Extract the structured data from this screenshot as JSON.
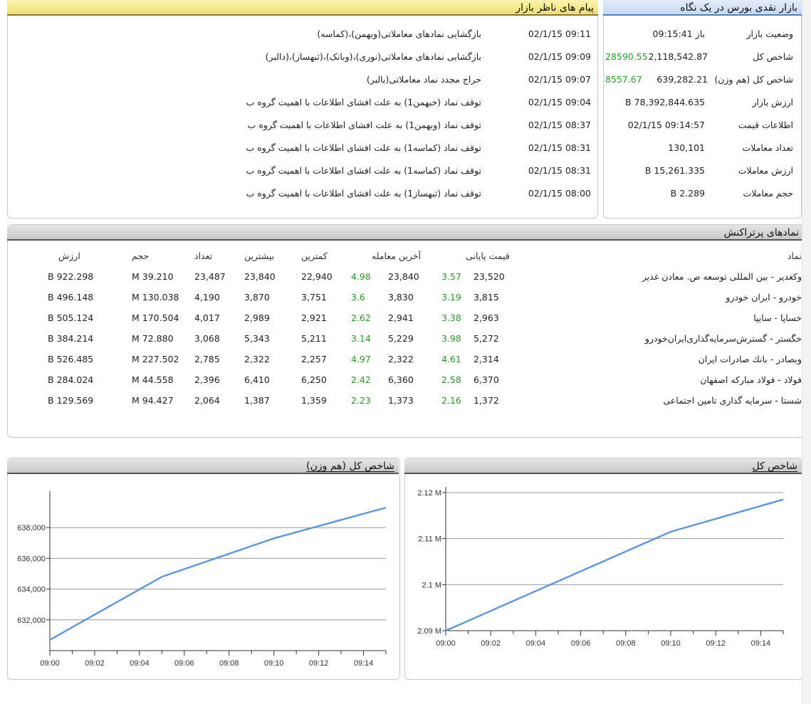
{
  "market_overview": {
    "title": "بازار نقدی بورس در یک نگاه",
    "rows": [
      {
        "label": "وضعیت بازار",
        "value": "باز 09:15:41",
        "extra": ""
      },
      {
        "label": "شاخص کل",
        "value": "2,118,542.87",
        "extra": "28590.55"
      },
      {
        "label": "شاخص کل (هم وزن)",
        "value": "639,282.21",
        "extra": "8557.67"
      },
      {
        "label": "ارزش بازار",
        "value": "78,392,844.635 B",
        "extra": ""
      },
      {
        "label": "اطلاعات قیمت",
        "value": "09:14:57 02/1/15",
        "extra": ""
      },
      {
        "label": "تعداد معاملات",
        "value": "130,101",
        "extra": ""
      },
      {
        "label": "ارزش معاملات",
        "value": "15,261.335 B",
        "extra": ""
      },
      {
        "label": "حجم معاملات",
        "value": "2.289 B",
        "extra": ""
      }
    ]
  },
  "messages": {
    "title": "پیام های ناظر بازار",
    "items": [
      {
        "time": "02/1/15 09:11",
        "text": "بازگشایی نمادهای معاملاتی(وبهمن)،(کماسه)"
      },
      {
        "time": "02/1/15 09:09",
        "text": "بازگشایی نمادهای معاملاتی(نوری)،(وبانک)،(ثبهساز)،(دالبر)"
      },
      {
        "time": "02/1/15 09:07",
        "text": "حراج مجدد نماد معاملاتی(بالبر)"
      },
      {
        "time": "02/1/15 09:04",
        "text": "توقف نماد (خبهمن1) به علت افشای اطلاعات با اهمیت گروه ب"
      },
      {
        "time": "02/1/15 08:37",
        "text": "توقف نماد (وبهمن1) به علت افشای اطلاعات با اهمیت گروه ب"
      },
      {
        "time": "02/1/15 08:31",
        "text": "توقف نماد (کماسه1) به علت افشای اطلاعات با اهمیت گروه ب"
      },
      {
        "time": "02/1/15 08:31",
        "text": "توقف نماد (کماسه1) به علت افشای اطلاعات با اهمیت گروه ب"
      },
      {
        "time": "02/1/15 08:00",
        "text": "توقف نماد (ثبهساز1) به علت افشای اطلاعات با اهمیت گروه ب"
      }
    ]
  },
  "effective_symbols": {
    "title": "نمادهای پرتراکنش",
    "headers": {
      "symbol": "نماد",
      "closing": "قیمت پایانی",
      "last": "آخرین معامله",
      "min": "کمترین",
      "max": "بیشترین",
      "count": "تعداد",
      "volume": "حجم",
      "value": "ارزش"
    },
    "rows": [
      {
        "symbol": "وکغدیر - بین المللی توسعه ص. معادن غدیر",
        "closing": "23,520",
        "closing_pct": "3.57",
        "last": "23,840",
        "last_pct": "4.98",
        "min": "22,940",
        "max": "23,840",
        "count": "23,487",
        "volume": "39.210 M",
        "value": "922.298 B"
      },
      {
        "symbol": "خودرو - ایران خودرو",
        "closing": "3,815",
        "closing_pct": "3.19",
        "last": "3,830",
        "last_pct": "3.6",
        "min": "3,751",
        "max": "3,870",
        "count": "4,190",
        "volume": "130.038 M",
        "value": "496.148 B"
      },
      {
        "symbol": "خساپا - سایپا",
        "closing": "2,963",
        "closing_pct": "3.38",
        "last": "2,941",
        "last_pct": "2.62",
        "min": "2,921",
        "max": "2,989",
        "count": "4,017",
        "volume": "170.504 M",
        "value": "505.124 B"
      },
      {
        "symbol": "خگستر - گسترش‌سرمایه‌گذاری‌ایران‌خودرو",
        "closing": "5,272",
        "closing_pct": "3.98",
        "last": "5,229",
        "last_pct": "3.14",
        "min": "5,211",
        "max": "5,343",
        "count": "3,068",
        "volume": "72.880 M",
        "value": "384.214 B"
      },
      {
        "symbol": "وبصادر - بانك صادرات ايران",
        "closing": "2,314",
        "closing_pct": "4.61",
        "last": "2,322",
        "last_pct": "4.97",
        "min": "2,257",
        "max": "2,322",
        "count": "2,785",
        "volume": "227.502 M",
        "value": "526.485 B"
      },
      {
        "symbol": "فولاد - فولاد مباركه اصفهان",
        "closing": "6,370",
        "closing_pct": "2.58",
        "last": "6,360",
        "last_pct": "2.42",
        "min": "6,250",
        "max": "6,410",
        "count": "2,396",
        "volume": "44.558 M",
        "value": "284.024 B"
      },
      {
        "symbol": "شستا - سرمایه گذاری تامین اجتماعی",
        "closing": "1,372",
        "closing_pct": "2.16",
        "last": "1,373",
        "last_pct": "2.23",
        "min": "1,359",
        "max": "1,387",
        "count": "2,064",
        "volume": "94.427 M",
        "value": "129.569 B"
      }
    ]
  },
  "colors": {
    "positive": "#2a9a2a",
    "line": "#5b96e0"
  },
  "chart_data": [
    {
      "type": "line",
      "title": "شاخص کل",
      "x": [
        "09:00",
        "09:10",
        "09:15"
      ],
      "series": [
        {
          "values": [
            2090000,
            2111500,
            2118500
          ]
        }
      ],
      "x_ticks": [
        "09:00",
        "09:02",
        "09:04",
        "09:06",
        "09:08",
        "09:10",
        "09:12",
        "09:14"
      ],
      "y_ticks": [
        "2.09 M",
        "2.1 M",
        "2.11 M",
        "2.12 M"
      ],
      "y_tick_values": [
        2090000,
        2100000,
        2110000,
        2120000
      ],
      "ylim": [
        2090000,
        2120000
      ],
      "xlim": [
        "09:00",
        "09:15"
      ],
      "grid": true
    },
    {
      "type": "line",
      "title": "شاخص کل (هم وزن)",
      "x": [
        "09:00",
        "09:05",
        "09:10",
        "09:15"
      ],
      "series": [
        {
          "values": [
            630700,
            634800,
            637300,
            639300
          ]
        }
      ],
      "x_ticks": [
        "09:00",
        "09:02",
        "09:04",
        "09:06",
        "09:08",
        "09:10",
        "09:12",
        "09:14"
      ],
      "y_ticks": [
        "632,000",
        "634,000",
        "636,000",
        "638,000"
      ],
      "y_tick_values": [
        632000,
        634000,
        636000,
        638000
      ],
      "ylim": [
        630000,
        640000
      ],
      "xlim": [
        "09:00",
        "09:15"
      ],
      "grid": true
    }
  ]
}
